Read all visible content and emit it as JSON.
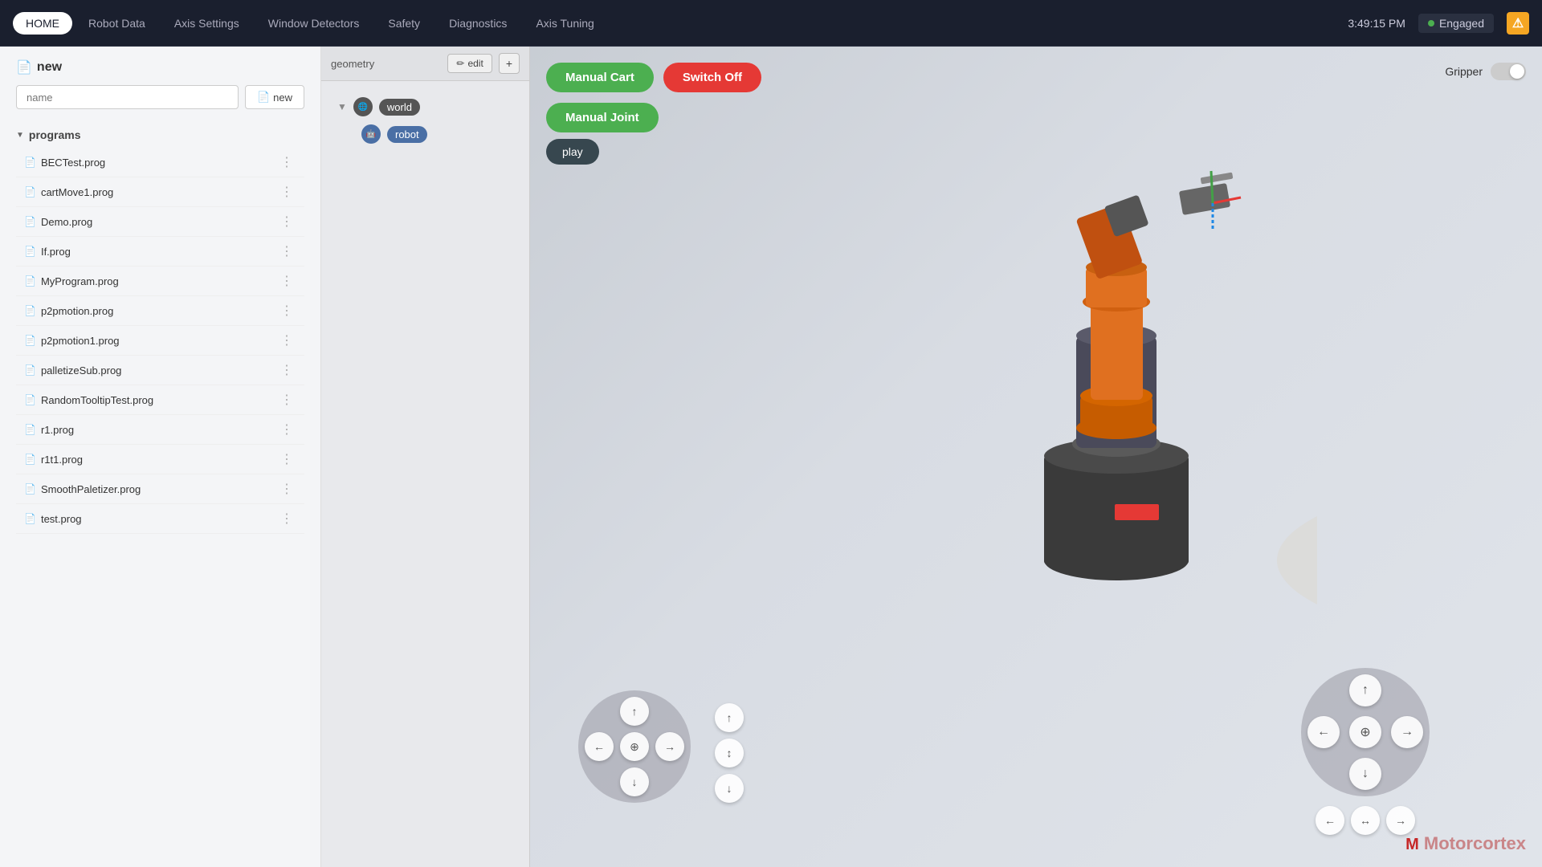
{
  "topbar": {
    "nav_items": [
      {
        "label": "HOME",
        "active": true
      },
      {
        "label": "Robot Data",
        "active": false
      },
      {
        "label": "Axis Settings",
        "active": false
      },
      {
        "label": "Window Detectors",
        "active": false
      },
      {
        "label": "Safety",
        "active": false
      },
      {
        "label": "Diagnostics",
        "active": false
      },
      {
        "label": "Axis Tuning",
        "active": false
      }
    ],
    "time": "3:49:15 PM",
    "status": "Engaged",
    "warn_icon": "⚠"
  },
  "sidebar": {
    "new_label": "new",
    "name_placeholder": "name",
    "new_btn_label": "new",
    "programs_label": "programs",
    "programs": [
      {
        "name": "BECTest.prog"
      },
      {
        "name": "cartMove1.prog"
      },
      {
        "name": "Demo.prog"
      },
      {
        "name": "If.prog"
      },
      {
        "name": "MyProgram.prog"
      },
      {
        "name": "p2pmotion.prog"
      },
      {
        "name": "p2pmotion1.prog"
      },
      {
        "name": "palletizeSub.prog"
      },
      {
        "name": "RandomTooltipTest.prog"
      },
      {
        "name": "r1.prog"
      },
      {
        "name": "r1t1.prog"
      },
      {
        "name": "SmoothPaletizer.prog"
      },
      {
        "name": "test.prog"
      }
    ]
  },
  "mid_panel": {
    "toolbar_label": "geometry",
    "edit_btn": "edit",
    "add_btn": "+",
    "world_node": "world",
    "robot_node": "robot"
  },
  "viewport": {
    "btn_manual_cart": "Manual Cart",
    "btn_switch_off": "Switch Off",
    "btn_manual_joint": "Manual Joint",
    "btn_play": "play",
    "gripper_label": "Gripper"
  },
  "joystick": {
    "up": "↑",
    "down": "↓",
    "left": "←",
    "right": "→",
    "center_move": "⊕",
    "center_vert": "↕",
    "center_horiz": "↔"
  },
  "mc_logo": "Motorcortex"
}
